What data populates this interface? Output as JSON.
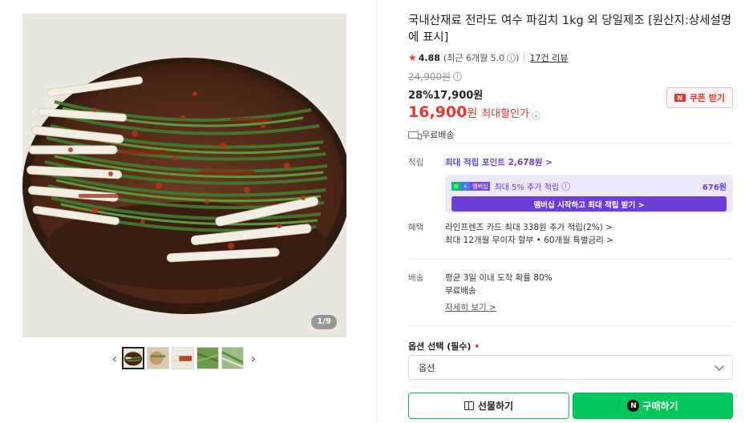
{
  "gallery": {
    "counter_current": "1",
    "counter_total": "/9",
    "prev_label": "‹",
    "next_label": "›"
  },
  "product": {
    "title": "국내산재료 전라도 여수 파김치 1kg 외 당일제조 [원산지:상세설명에 표시]",
    "rating_score": "4.88",
    "rating_recent": "(최근 6개월 5.0",
    "rating_close": ")",
    "review_link": "17건 리뷰",
    "original_price": "24,900원",
    "discount_rate": "28%",
    "sale_price": "17,900원",
    "best_price_num": "16,900",
    "best_price_won": "원",
    "best_price_label": "최대할인가",
    "coupon_label": "쿠폰 받기",
    "shipping": "무료배송"
  },
  "points": {
    "label": "적립",
    "link": "최대 적립 포인트 2,678원 >",
    "box_text": "최대 5% 추가 적립",
    "box_amount": "676원",
    "box_button": "멤버십 시작하고 최대 적립 받기 >"
  },
  "benefits": {
    "label": "혜택",
    "line1": "라인프렌즈 카드 최대 338원 추가 적립(2%) >",
    "line2": "최대 12개월 무이자 할부 • 60개월 특별금리 >"
  },
  "delivery": {
    "label": "배송",
    "line1": "평균 3일 이내 도착 확률 80%",
    "line2": "무료배송",
    "detail_link": "자세히 보기 >"
  },
  "options": {
    "label": "옵션 선택 (필수)",
    "required_mark": "•",
    "select_value": "옵션"
  },
  "actions": {
    "gift_label": "선물하기",
    "buy_label": "구매하기",
    "npay_mark": "N"
  },
  "colors": {
    "accent_red": "#e8362c",
    "naver_green": "#03c75a",
    "membership_purple": "#6b3fd7"
  }
}
